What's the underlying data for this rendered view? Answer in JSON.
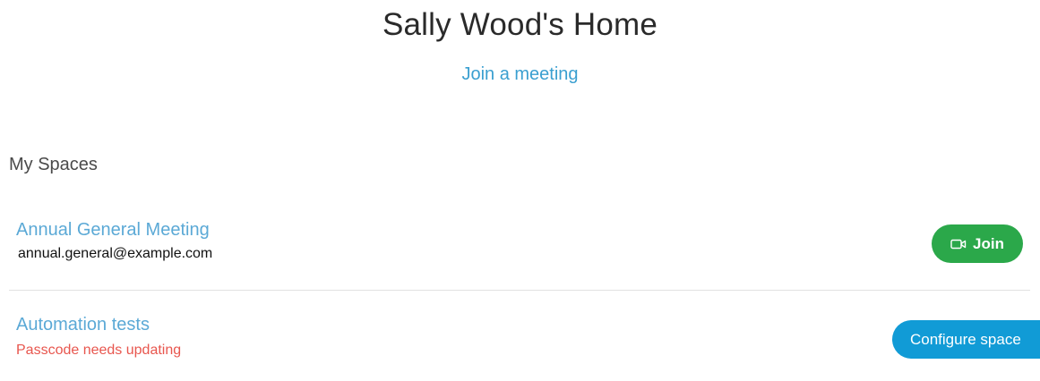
{
  "header": {
    "title": "Sally Wood's Home",
    "join_meeting_label": "Join a meeting"
  },
  "spaces": {
    "heading": "My Spaces",
    "items": [
      {
        "name": "Annual General Meeting",
        "subtitle": "annual.general@example.com",
        "action_label": "Join",
        "action_icon": "video-camera-icon",
        "action_color": "#2ba84a"
      },
      {
        "name": "Automation tests",
        "warning": "Passcode needs updating",
        "warning_color": "#e8564e",
        "action_label": "Configure space",
        "action_color": "#119bd6"
      }
    ]
  },
  "colors": {
    "link": "#3a9fd0",
    "space_name": "#5ba9d6",
    "title": "#2a2a2a"
  }
}
